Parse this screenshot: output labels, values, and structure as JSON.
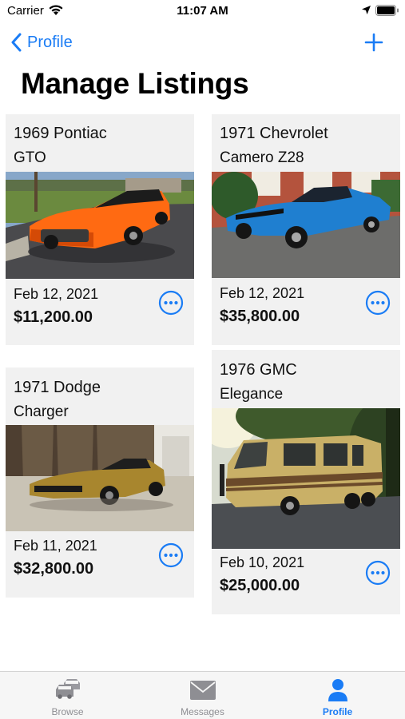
{
  "status_bar": {
    "carrier": "Carrier",
    "time": "11:07 AM"
  },
  "nav": {
    "back_label": "Profile"
  },
  "page_title": "Manage Listings",
  "listings": [
    {
      "line1": "1969 Pontiac",
      "line2": "GTO",
      "date": "Feb 12, 2021",
      "price": "$11,200.00",
      "car_color": "#ff6a12"
    },
    {
      "line1": "1971 Chevrolet",
      "line2": "Camero Z28",
      "date": "Feb 12, 2021",
      "price": "$35,800.00",
      "car_color": "#1f7fd0"
    },
    {
      "line1": "1971 Dodge",
      "line2": "Charger",
      "date": "Feb 11, 2021",
      "price": "$32,800.00",
      "car_color": "#a8862e"
    },
    {
      "line1": "1976 GMC",
      "line2": "Elegance",
      "date": "Feb 10, 2021",
      "price": "$25,000.00",
      "car_color": "#c9b067"
    }
  ],
  "tabs": [
    {
      "label": "Browse",
      "icon": "cars-icon"
    },
    {
      "label": "Messages",
      "icon": "envelope-icon"
    },
    {
      "label": "Profile",
      "icon": "person-icon",
      "active": true
    }
  ],
  "colors": {
    "accent": "#1a7cf5",
    "card_bg": "#f1f1f1",
    "tab_inactive": "#8e8e93"
  }
}
